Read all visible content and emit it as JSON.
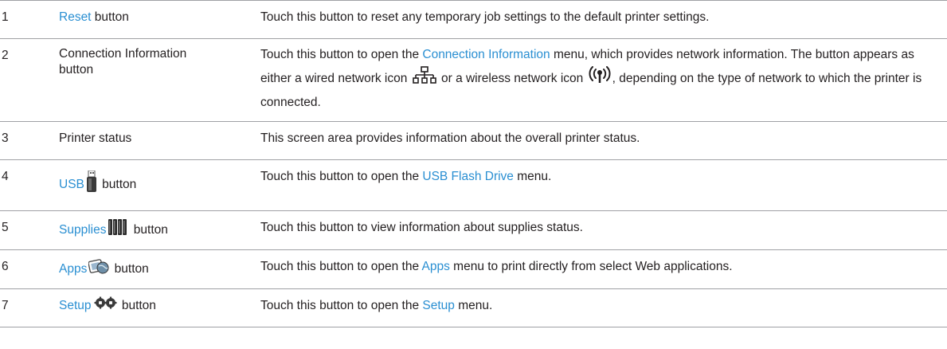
{
  "rows": [
    {
      "number": "1",
      "item_link": "Reset",
      "item_suffix": " button",
      "desc_pre": "Touch this button to reset any temporary job settings to the default printer settings."
    },
    {
      "number": "2",
      "item_text": "Connection Information button",
      "desc_pre": "Touch this button to open the ",
      "desc_link": "Connection Information",
      "desc_mid": " menu, which provides network information. The button appears as either a wired network icon ",
      "desc_mid2": " or a wireless network icon ",
      "desc_post": ", depending on the type of network to which the printer is connected.",
      "icons": [
        "wired-network-icon",
        "wireless-network-icon"
      ]
    },
    {
      "number": "3",
      "item_text": "Printer status",
      "desc_pre": "This screen area provides information about the overall printer status."
    },
    {
      "number": "4",
      "item_link": "USB",
      "item_suffix": " button",
      "icon": "usb-drive-icon",
      "desc_pre": "Touch this button to open the ",
      "desc_link": "USB Flash Drive",
      "desc_post": " menu."
    },
    {
      "number": "5",
      "item_link": "Supplies",
      "item_suffix": " button",
      "icon": "supplies-icon",
      "desc_pre": "Touch this button to view information about supplies status."
    },
    {
      "number": "6",
      "item_link": "Apps",
      "item_suffix": " button",
      "icon": "apps-icon",
      "desc_pre": "Touch this button to open the ",
      "desc_link": "Apps",
      "desc_post": " menu to print directly from select Web applications."
    },
    {
      "number": "7",
      "item_link": "Setup",
      "item_suffix": " button",
      "icon": "setup-gears-icon",
      "desc_pre": "Touch this button to open the ",
      "desc_link": "Setup",
      "desc_post": " menu."
    }
  ],
  "colors": {
    "link": "#2a8fd2",
    "text": "#231f20",
    "rule": "#9fa0a4"
  }
}
